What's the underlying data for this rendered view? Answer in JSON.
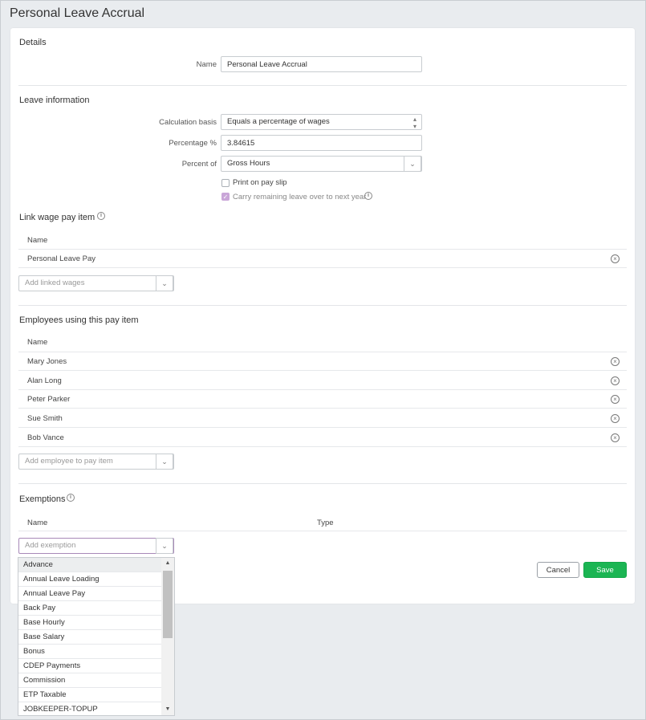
{
  "page": {
    "title": "Personal Leave Accrual"
  },
  "details": {
    "heading": "Details",
    "name_label": "Name",
    "name_value": "Personal Leave Accrual"
  },
  "leave_info": {
    "heading": "Leave information",
    "calc_basis_label": "Calculation basis",
    "calc_basis_value": "Equals a percentage of wages",
    "percentage_label": "Percentage %",
    "percentage_value": "3.84615",
    "percent_of_label": "Percent of",
    "percent_of_value": "Gross Hours",
    "print_on_payslip_label": "Print on pay slip",
    "print_on_payslip_checked": false,
    "carry_over_label": "Carry remaining leave over to next year",
    "carry_over_checked": true
  },
  "linked_wages": {
    "heading": "Link wage pay item",
    "column_name": "Name",
    "rows": [
      "Personal Leave Pay"
    ],
    "add_placeholder": "Add linked wages"
  },
  "employees": {
    "heading": "Employees using this pay item",
    "column_name": "Name",
    "rows": [
      "Mary Jones",
      "Alan Long",
      "Peter Parker",
      "Sue Smith",
      "Bob Vance"
    ],
    "add_placeholder": "Add employee to pay item"
  },
  "exemptions": {
    "heading": "Exemptions",
    "column_name": "Name",
    "column_type": "Type",
    "add_placeholder": "Add exemption",
    "dropdown_options": [
      "Advance",
      "Annual Leave Loading",
      "Annual Leave Pay",
      "Back Pay",
      "Base Hourly",
      "Base Salary",
      "Bonus",
      "CDEP Payments",
      "Commission",
      "ETP Taxable",
      "JOBKEEPER-TOPUP"
    ]
  },
  "actions": {
    "cancel_label": "Cancel",
    "save_label": "Save"
  },
  "colors": {
    "save_green": "#1bb553",
    "checkbox_purple": "#c9a6d8",
    "focus_border": "#a889b8"
  }
}
